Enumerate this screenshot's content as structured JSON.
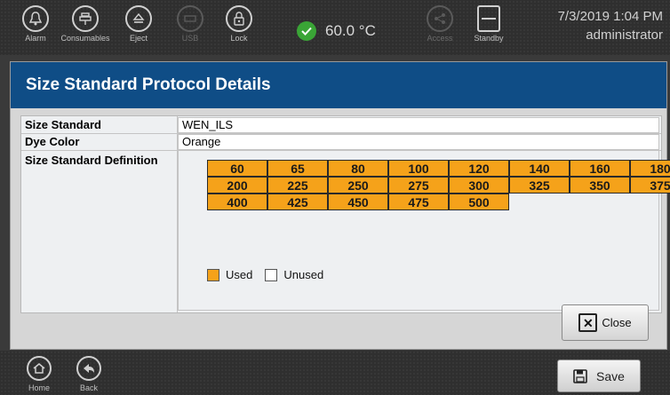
{
  "toolbar": {
    "buttons": [
      {
        "label": "Alarm",
        "icon": "bell-icon"
      },
      {
        "label": "Consumables",
        "icon": "consumables-icon"
      },
      {
        "label": "Eject",
        "icon": "eject-icon"
      },
      {
        "label": "USB",
        "icon": "usb-icon"
      },
      {
        "label": "Lock",
        "icon": "lock-icon"
      },
      {
        "label": "Access",
        "icon": "share-icon"
      },
      {
        "label": "Standby",
        "icon": "standby-icon"
      }
    ],
    "temperature": "60.0 °C",
    "status_color": "#3aa536",
    "datetime": "7/3/2019 1:04 PM",
    "user": "administrator"
  },
  "dialog": {
    "title": "Size Standard Protocol Details",
    "size_standard_label": "Size Standard",
    "size_standard_value": "WEN_ILS",
    "dye_color_label": "Dye Color",
    "dye_color_value": "Orange",
    "definition_label": "Size Standard Definition",
    "sizes": [
      "60",
      "65",
      "80",
      "100",
      "120",
      "140",
      "160",
      "180",
      "200",
      "225",
      "250",
      "275",
      "300",
      "325",
      "350",
      "375",
      "400",
      "425",
      "450",
      "475",
      "500"
    ],
    "legend_used": "Used",
    "legend_unused": "Unused",
    "used_color": "#f5a21a",
    "close_label": "Close"
  },
  "footer": {
    "home_label": "Home",
    "back_label": "Back",
    "save_label": "Save"
  }
}
